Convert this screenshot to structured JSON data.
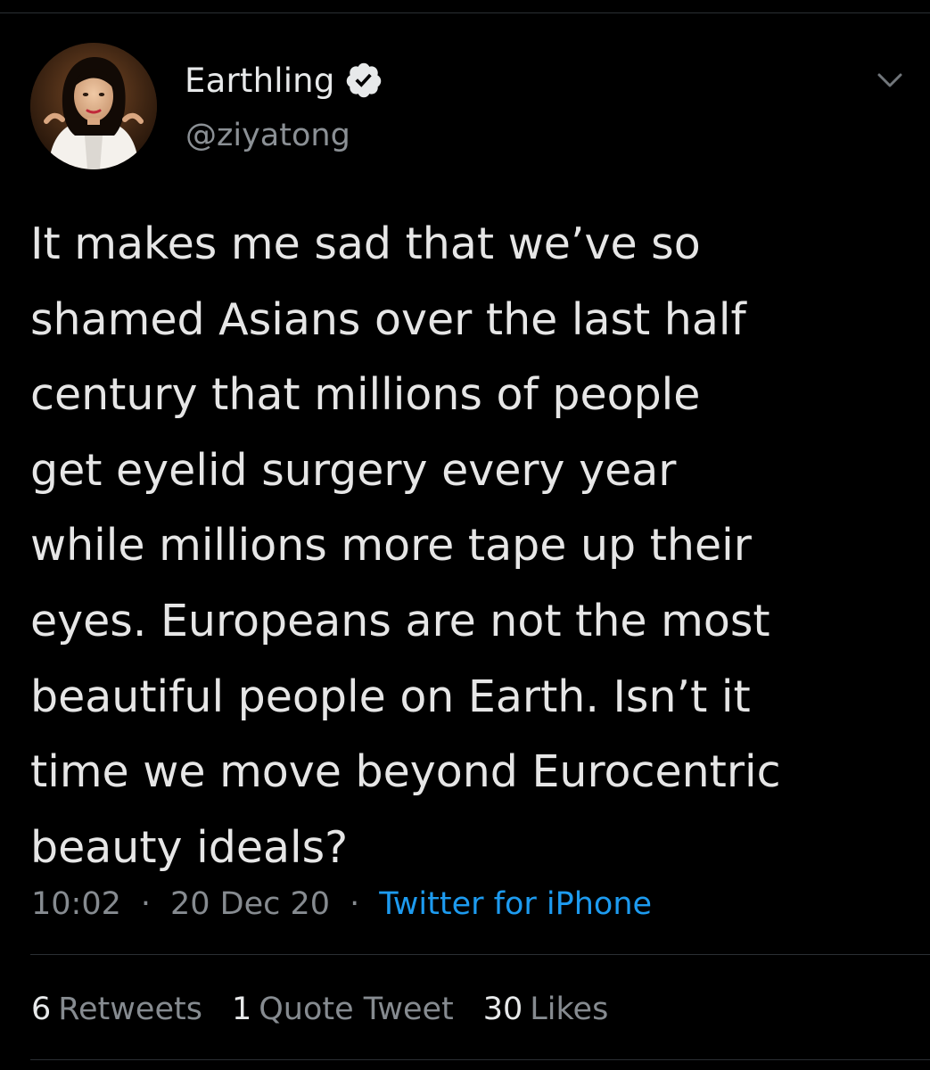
{
  "tweet": {
    "author": {
      "display_name": "Earthling",
      "handle": "@ziyatong",
      "verified": true
    },
    "text_lines": [
      "It makes me sad that we’ve so",
      "shamed Asians over the last half",
      "century that millions of people",
      "get eyelid surgery every year",
      "while millions more tape up their",
      "eyes. Europeans are not the most",
      "beautiful people on Earth. Isn’t it",
      "time we move beyond Eurocentric",
      "beauty ideals?"
    ],
    "meta": {
      "time": "10:02",
      "separator": "·",
      "date": "20 Dec 20",
      "source": "Twitter for iPhone"
    },
    "stats": {
      "retweets": {
        "count": "6",
        "label": "Retweets"
      },
      "quotes": {
        "count": "1",
        "label": "Quote Tweet"
      },
      "likes": {
        "count": "30",
        "label": "Likes"
      }
    }
  },
  "icons": {
    "avatar": "profile-photo",
    "verified": "verified-badge-icon",
    "menu": "chevron-down-icon"
  },
  "colors": {
    "background": "#000000",
    "primary_text": "#e7e9ea",
    "secondary_text": "#868b90",
    "link": "#1d9bf0",
    "divider": "#2a2f33"
  }
}
